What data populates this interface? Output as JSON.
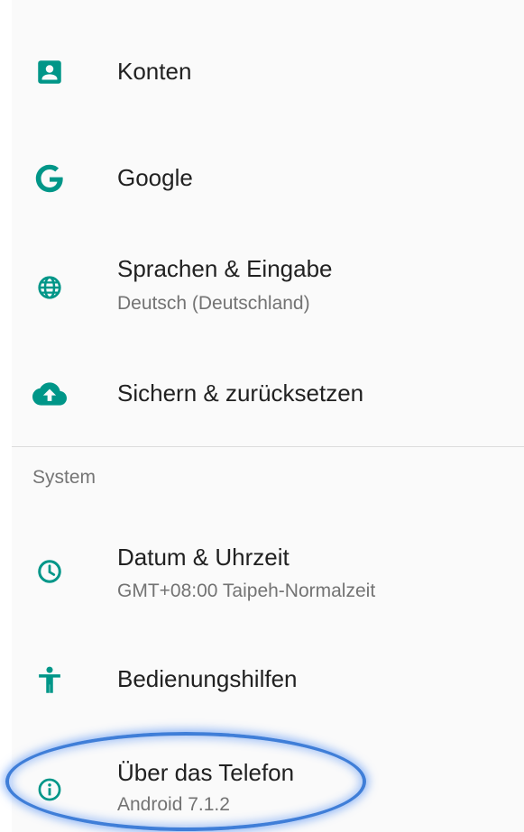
{
  "colors": {
    "accent": "#009688",
    "title_text": "#212121",
    "summary_text": "#737373",
    "highlight": "#3f7ed8"
  },
  "items": [
    {
      "title": "Konten",
      "icon": "account-box-icon"
    },
    {
      "title": "Google",
      "icon": "google-icon"
    },
    {
      "title": "Sprachen & Eingabe",
      "summary": "Deutsch (Deutschland)",
      "icon": "globe-icon"
    },
    {
      "title": "Sichern & zurücksetzen",
      "icon": "cloud-upload-icon"
    }
  ],
  "system": {
    "header": "System",
    "items": [
      {
        "title": "Datum & Uhrzeit",
        "summary": "GMT+08:00 Taipeh-Normalzeit",
        "icon": "clock-icon"
      },
      {
        "title": "Bedienungshilfen",
        "icon": "accessibility-icon"
      },
      {
        "title": "Über das Telefon",
        "summary": "Android 7.1.2",
        "icon": "info-icon"
      }
    ]
  }
}
